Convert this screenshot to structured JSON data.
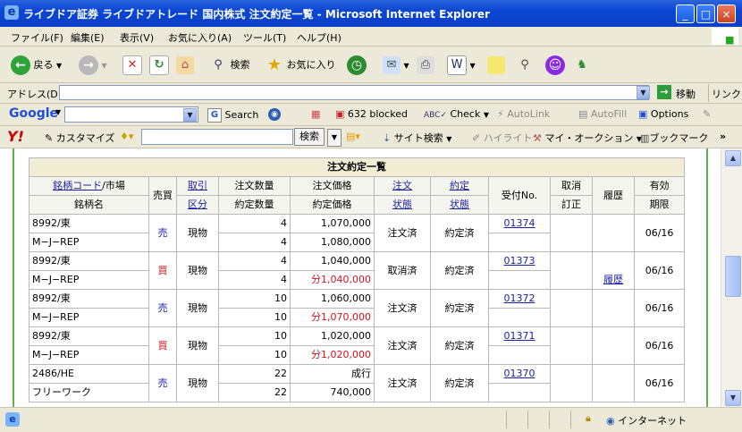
{
  "window": {
    "title": "ライブドア証券 ライブドアトレード 国内株式 注文約定一覧 - Microsoft Internet Explorer",
    "ie_icon": "ie-e-icon",
    "minimize": "_",
    "maximize": "□",
    "close": "×"
  },
  "menubar": {
    "items": [
      "ファイル(F)",
      "編集(E)",
      "表示(V)",
      "お気に入り(A)",
      "ツール(T)",
      "ヘルプ(H)"
    ]
  },
  "toolbar": {
    "back": "戻る",
    "search": "検索",
    "favorites": "お気に入り"
  },
  "addressbar": {
    "label": "アドレス(D)",
    "url": "",
    "go": "移動",
    "links": "リンク"
  },
  "googlebar": {
    "logo": "Google",
    "search": "Search",
    "blocked": "632 blocked",
    "check": "Check",
    "autolink": "AutoLink",
    "autofill": "AutoFill",
    "options": "Options"
  },
  "yahoobar": {
    "logo": "Y!",
    "customize": "カスタマイズ",
    "search_button": "検索",
    "site_search": "サイト検索",
    "highlight": "ハイライト",
    "my_auction": "マイ・オークション",
    "bookmark": "ブックマーク",
    "more": "»"
  },
  "table": {
    "caption": "注文約定一覧",
    "headers": {
      "code": "銘柄コード",
      "market": "/市場",
      "name": "銘柄名",
      "side": "売買",
      "type1": "取引",
      "type2": "区分",
      "qty": "注文数量",
      "fill_qty": "約定数量",
      "price": "注文価格",
      "fill_price": "約定価格",
      "ostatus1": "注文",
      "ostatus2": "状態",
      "fstatus1": "約定",
      "fstatus2": "状態",
      "receipt": "受付No.",
      "cancel1": "取消",
      "cancel2": "訂正",
      "history": "履歴",
      "expiry1": "有効",
      "expiry2": "期限"
    },
    "rows": [
      {
        "code": "8992/東",
        "name": "M−J−REP",
        "side": "売",
        "kind": "現物",
        "qty": "4",
        "fill_qty": "4",
        "price": "1,070,000",
        "fill_price": "1,080,000",
        "fill_red": false,
        "ostatus": "注文済",
        "fstatus": "約定済",
        "receipt": "01374",
        "history": "",
        "expiry": "06/16"
      },
      {
        "code": "8992/東",
        "name": "M−J−REP",
        "side": "買",
        "kind": "現物",
        "qty": "4",
        "fill_qty": "4",
        "price": "1,040,000",
        "fill_price": "分1,040,000",
        "fill_red": true,
        "ostatus": "取消済",
        "fstatus": "約定済",
        "receipt": "01373",
        "history": "履歴",
        "expiry": "06/16"
      },
      {
        "code": "8992/東",
        "name": "M−J−REP",
        "side": "売",
        "kind": "現物",
        "qty": "10",
        "fill_qty": "10",
        "price": "1,060,000",
        "fill_price": "分1,070,000",
        "fill_red": true,
        "ostatus": "注文済",
        "fstatus": "約定済",
        "receipt": "01372",
        "history": "",
        "expiry": "06/16"
      },
      {
        "code": "8992/東",
        "name": "M−J−REP",
        "side": "買",
        "kind": "現物",
        "qty": "10",
        "fill_qty": "10",
        "price": "1,020,000",
        "fill_price": "分1,020,000",
        "fill_red": true,
        "ostatus": "注文済",
        "fstatus": "約定済",
        "receipt": "01371",
        "history": "",
        "expiry": "06/16"
      },
      {
        "code": "2486/HE",
        "name": "フリーワーク",
        "side": "売",
        "kind": "現物",
        "qty": "22",
        "fill_qty": "22",
        "price": "成行",
        "fill_price": "740,000",
        "fill_red": false,
        "ostatus": "注文済",
        "fstatus": "約定済",
        "receipt": "01370",
        "history": "",
        "expiry": "06/16"
      }
    ]
  },
  "statusbar": {
    "zone": "インターネット"
  },
  "colors": {
    "titlebar": "#0a46d4",
    "chrome": "#ece9d8",
    "caption_bg": "#f1edd5",
    "link": "#1c20a3",
    "red": "#d0121b",
    "frame_green": "#5fae48"
  }
}
